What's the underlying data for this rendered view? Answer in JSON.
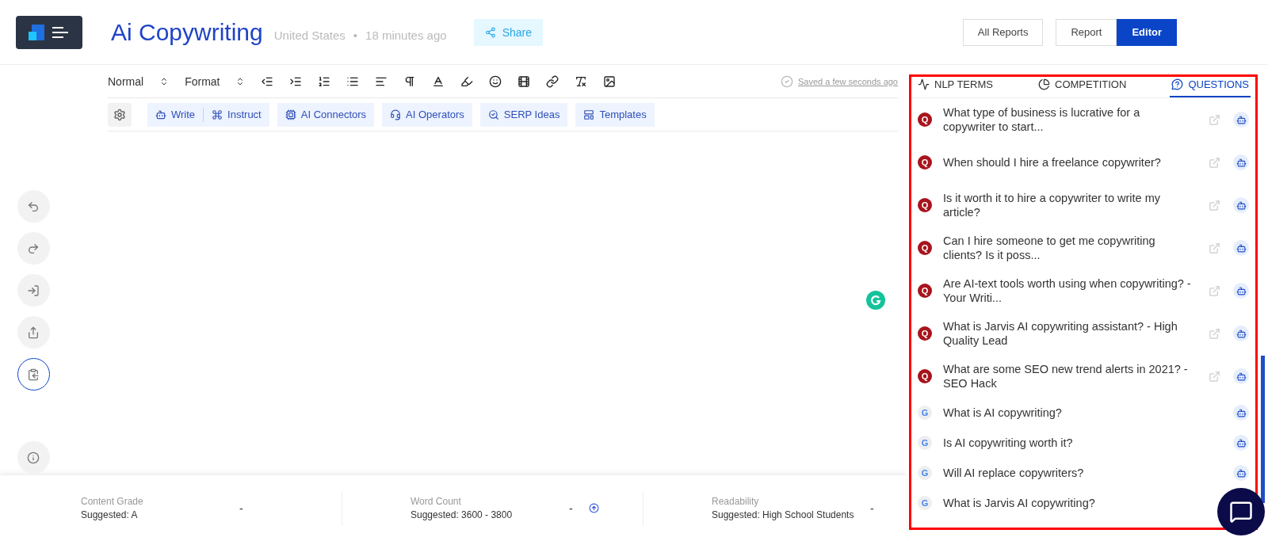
{
  "header": {
    "title": "Ai Copywriting",
    "location": "United States",
    "separator": "•",
    "time": "18 minutes ago",
    "share": "Share",
    "nav": [
      {
        "label": "All Reports",
        "selected": false
      },
      {
        "label": "Report",
        "selected": false
      },
      {
        "label": "Editor",
        "selected": true
      }
    ]
  },
  "format_toolbar": {
    "dropdowns": [
      "Normal",
      "Format"
    ],
    "saved": "Saved a few seconds ago"
  },
  "ai_toolbar": [
    {
      "label": "Write",
      "kind": "write"
    },
    {
      "label": "Instruct",
      "kind": "instruct"
    },
    {
      "label": "AI Connectors",
      "kind": "connectors"
    },
    {
      "label": "AI Operators",
      "kind": "operators"
    },
    {
      "label": "SERP Ideas",
      "kind": "serp"
    },
    {
      "label": "Templates",
      "kind": "templates"
    }
  ],
  "side_tools": [
    {
      "kind": "undo",
      "selected": false
    },
    {
      "kind": "redo",
      "selected": false
    },
    {
      "kind": "import",
      "selected": false
    },
    {
      "kind": "export",
      "selected": false
    },
    {
      "kind": "paste",
      "selected": true
    },
    {
      "kind": "info",
      "selected": false
    }
  ],
  "panel": {
    "tabs": [
      {
        "label": "NLP TERMS",
        "kind": "nlp",
        "selected": false
      },
      {
        "label": "COMPETITION",
        "kind": "competition",
        "selected": false
      },
      {
        "label": "QUESTIONS",
        "kind": "questions",
        "selected": true
      }
    ],
    "questions": [
      {
        "text": "What type of business is lucrative for a copywriter to start...",
        "kind": "quora",
        "mark": "Q"
      },
      {
        "text": "When should I hire a freelance copywriter?",
        "kind": "quora",
        "mark": "Q"
      },
      {
        "text": "Is it worth it to hire a copywriter to write my article?",
        "kind": "quora",
        "mark": "Q"
      },
      {
        "text": "Can I hire someone to get me copywriting clients? Is it poss...",
        "kind": "quora",
        "mark": "Q"
      },
      {
        "text": "Are AI-text tools worth using when copywriting? - Your Writi...",
        "kind": "quora",
        "mark": "Q"
      },
      {
        "text": "What is Jarvis AI copywriting assistant? - High Quality Lead",
        "kind": "quora",
        "mark": "Q"
      },
      {
        "text": "What are some SEO new trend alerts in 2021? - SEO Hack",
        "kind": "quora",
        "mark": "Q"
      },
      {
        "text": "What is AI copywriting?",
        "kind": "google",
        "mark": "G"
      },
      {
        "text": "Is AI copywriting worth it?",
        "kind": "google",
        "mark": "G"
      },
      {
        "text": "Will AI replace copywriters?",
        "kind": "google",
        "mark": "G"
      },
      {
        "text": "What is Jarvis AI copywriting?",
        "kind": "google",
        "mark": "G",
        "bot": false
      }
    ]
  },
  "stats": [
    {
      "label": "Content Grade",
      "suggested": "Suggested: A",
      "value": "-",
      "info": false
    },
    {
      "label": "Word Count",
      "suggested": "Suggested: 3600 - 3800",
      "value": "-",
      "info": true
    },
    {
      "label": "Readability",
      "suggested": "Suggested: High School Students",
      "value": "-",
      "info": false
    }
  ]
}
